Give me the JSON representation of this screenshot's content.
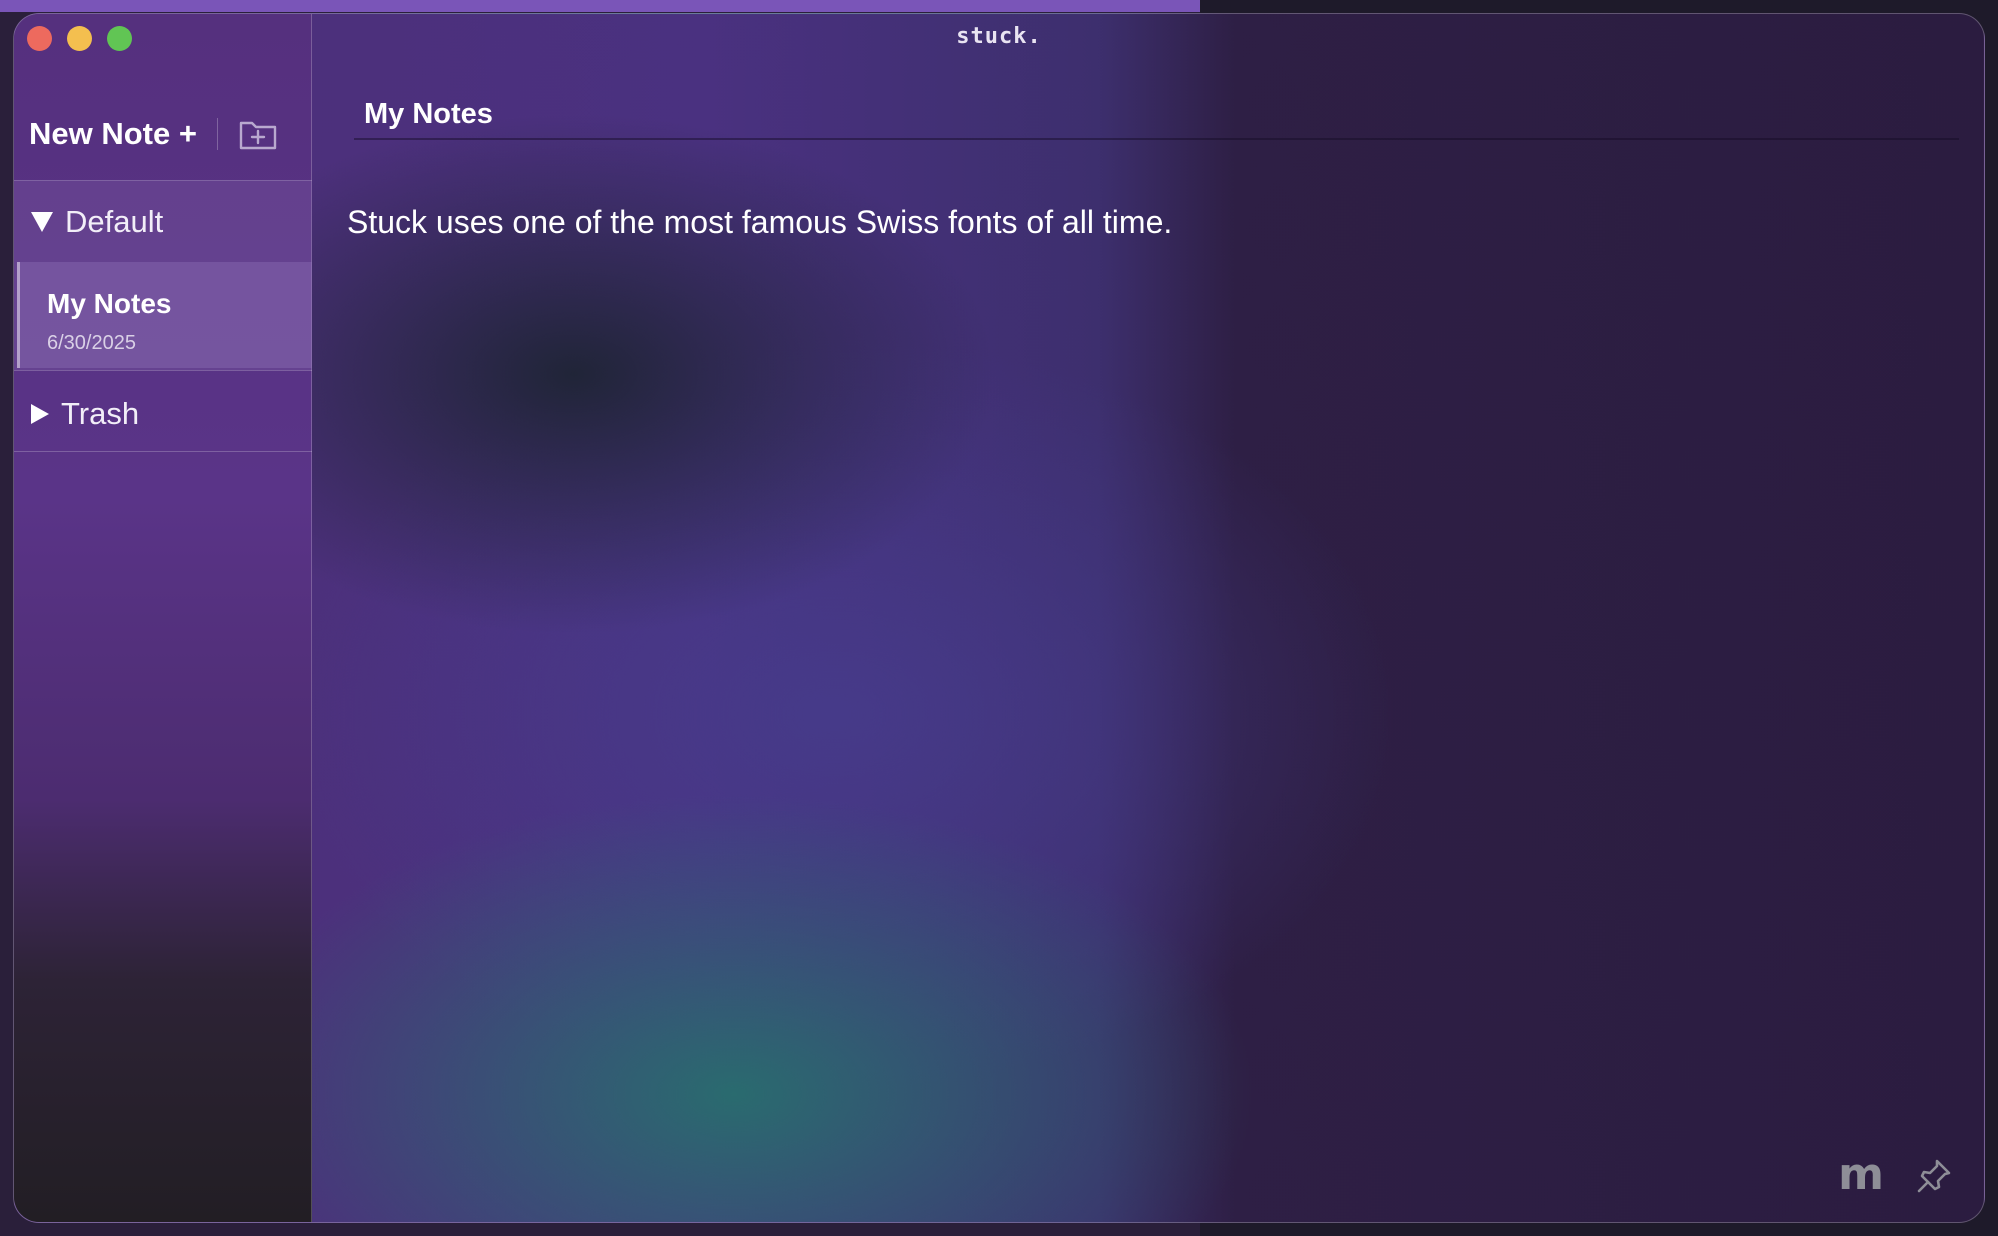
{
  "window": {
    "title": "stuck."
  },
  "sidebar": {
    "new_note_label": "New Note +",
    "new_folder_icon": "folder-plus-icon",
    "groups": [
      {
        "label": "Default",
        "expanded": true,
        "notes": [
          {
            "title": "My Notes",
            "date": "6/30/2025"
          }
        ]
      },
      {
        "label": "Trash",
        "expanded": false,
        "notes": []
      }
    ]
  },
  "main": {
    "title": "My Notes",
    "body": "Stuck uses one of the most famous Swiss fonts of all time."
  },
  "footer": {
    "m_label": "m",
    "pin_icon": "pin-icon"
  },
  "colors": {
    "close": "#ed6a5e",
    "minimize": "#f4bf4f",
    "maximize": "#61c554"
  }
}
